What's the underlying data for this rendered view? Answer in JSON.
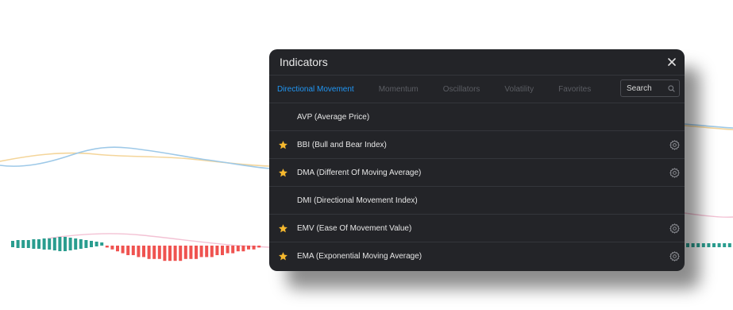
{
  "dialog": {
    "title": "Indicators",
    "tabs": [
      {
        "label": "Directional Movement",
        "active": true
      },
      {
        "label": "Momentum",
        "active": false
      },
      {
        "label": "Oscillators",
        "active": false
      },
      {
        "label": "Volatility",
        "active": false
      },
      {
        "label": "Favorites",
        "active": false
      }
    ],
    "search": {
      "placeholder": "Search",
      "value": ""
    },
    "indicators": [
      {
        "label": "AVP (Average Price)",
        "favorite": false,
        "settings": false
      },
      {
        "label": "BBI (Bull and Bear Index)",
        "favorite": true,
        "settings": true
      },
      {
        "label": "DMA (Different Of Moving Average)",
        "favorite": true,
        "settings": true
      },
      {
        "label": "DMI (Directional Movement Index)",
        "favorite": false,
        "settings": false
      },
      {
        "label": "EMV (Ease Of Movement Value)",
        "favorite": true,
        "settings": true
      },
      {
        "label": "EMA (Exponential Moving Average)",
        "favorite": true,
        "settings": true
      }
    ]
  },
  "colors": {
    "active_tab": "#2196f3",
    "star": "#f5b82e",
    "positive_bar": "#2a9d8f",
    "negative_bar": "#ef5350",
    "line_blue": "#9ec9e8",
    "line_orange": "#f4d59a",
    "line_pink": "#f3c2d4"
  }
}
